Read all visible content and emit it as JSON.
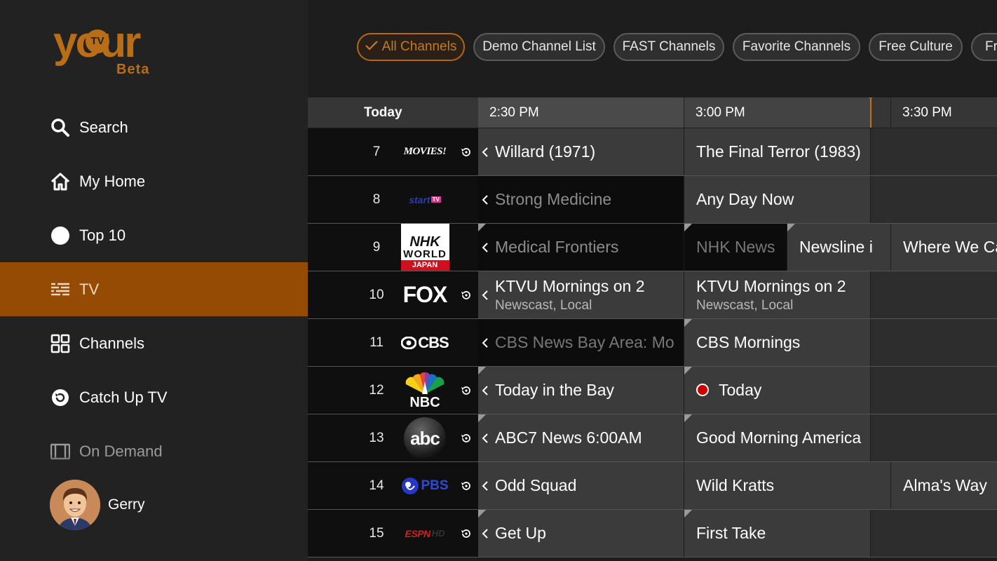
{
  "brand": {
    "logo_text": "your",
    "logo_badge": "TV",
    "logo_sub": "Beta",
    "accent": "#b96d16",
    "active_bg": "#954b03"
  },
  "sidebar": {
    "items": [
      {
        "label": "Search",
        "icon": "search-icon"
      },
      {
        "label": "My Home",
        "icon": "home-icon"
      },
      {
        "label": "Top 10",
        "icon": "circle-icon"
      },
      {
        "label": "TV",
        "icon": "guide-icon",
        "active": true
      },
      {
        "label": "Channels",
        "icon": "grid-icon"
      },
      {
        "label": "Catch Up TV",
        "icon": "replay-icon"
      },
      {
        "label": "On Demand",
        "icon": "film-icon"
      }
    ],
    "user": {
      "name": "Gerry"
    }
  },
  "chips": [
    {
      "label": "All Channels",
      "active": true
    },
    {
      "label": "Demo Channel List"
    },
    {
      "label": "FAST Channels"
    },
    {
      "label": "Favorite Channels"
    },
    {
      "label": "Free Culture"
    },
    {
      "label": "Fre"
    }
  ],
  "guide": {
    "day": "Today",
    "times": [
      "2:30 PM",
      "3:00 PM",
      "3:30 PM"
    ],
    "rows": [
      {
        "num": "7",
        "logo": "MOVIES!",
        "replay": true,
        "programs": [
          "Willard (1971)",
          "The Final Terror (1983)"
        ]
      },
      {
        "num": "8",
        "logo": "start",
        "logo_badge": "TV",
        "replay": false,
        "programs": [
          "Strong Medicine",
          "Any Day Now"
        ]
      },
      {
        "num": "9",
        "logo": "NHK WORLD JAPAN",
        "logo_lines": [
          "NHK",
          "WORLD",
          "JAPAN"
        ],
        "replay": false,
        "programs": [
          "Medical Frontiers",
          "NHK News",
          "Newsline i",
          "Where We Ca"
        ]
      },
      {
        "num": "10",
        "logo": "FOX",
        "replay": true,
        "programs": [
          "KTVU Mornings on 2",
          "KTVU Mornings on 2"
        ],
        "subs": [
          "Newscast, Local",
          "Newscast, Local"
        ]
      },
      {
        "num": "11",
        "logo": "CBS",
        "replay": false,
        "programs": [
          "CBS News Bay Area: Mo",
          "CBS Mornings"
        ]
      },
      {
        "num": "12",
        "logo": "NBC",
        "replay": true,
        "programs": [
          "Today in the Bay",
          "Today"
        ]
      },
      {
        "num": "13",
        "logo": "abc",
        "replay": true,
        "programs": [
          "ABC7 News 6:00AM",
          "Good Morning America"
        ]
      },
      {
        "num": "14",
        "logo": "PBS",
        "replay": true,
        "programs": [
          "Odd Squad",
          "Wild Kratts",
          "Alma's Way"
        ]
      },
      {
        "num": "15",
        "logo": "ESPN",
        "logo_suffix": "HD",
        "replay": true,
        "programs": [
          "Get Up",
          "First Take"
        ]
      }
    ]
  }
}
